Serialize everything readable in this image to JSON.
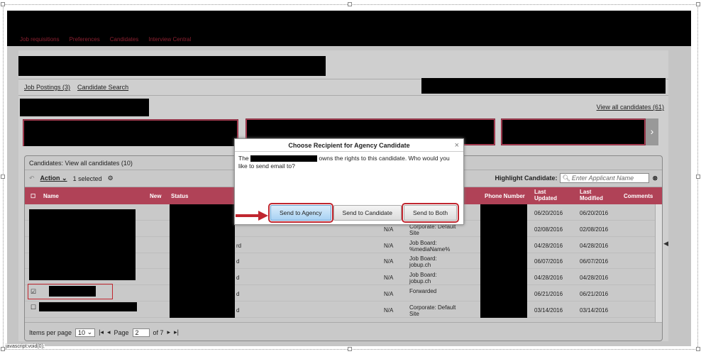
{
  "nav": [
    "Job requisitions",
    "Preferences",
    "Candidates",
    "Interview Central"
  ],
  "links": {
    "postings": "Job Postings (3)",
    "search": "Candidate Search"
  },
  "view_all": "View all candidates (61)",
  "grid": {
    "title": "Candidates: View all candidates (10)",
    "action": "Action",
    "selected": "1 selected",
    "highlight_label": "Highlight Candidate:",
    "highlight_placeholder": "Enter Applicant Name",
    "headers": {
      "name": "Name",
      "new": "New",
      "status": "Status",
      "phone": "Phone Number",
      "last_updated": "Last Updated",
      "last_modified": "Last Modified",
      "comments": "Comments"
    },
    "rows": [
      {
        "na": "",
        "source": "",
        "updated": "06/20/2016",
        "modified": "06/20/2016",
        "status_suffix": ""
      },
      {
        "na": "N/A",
        "source": "Corporate: Default Site",
        "updated": "02/08/2016",
        "modified": "02/08/2016",
        "status_suffix": ""
      },
      {
        "na": "N/A",
        "source": "Job Board: %mediaName%",
        "updated": "04/28/2016",
        "modified": "04/28/2016",
        "status_suffix": "rd"
      },
      {
        "na": "N/A",
        "source": "Job Board: jobup.ch",
        "updated": "06/07/2016",
        "modified": "06/07/2016",
        "status_suffix": "d"
      },
      {
        "na": "N/A",
        "source": "Job Board: jobup.ch",
        "updated": "04/28/2016",
        "modified": "04/28/2016",
        "status_suffix": "d"
      },
      {
        "na": "N/A",
        "source": "Forwarded",
        "updated": "06/21/2016",
        "modified": "06/21/2016",
        "status_suffix": "d"
      },
      {
        "na": "N/A",
        "source": "Corporate: Default Site",
        "updated": "03/14/2016",
        "modified": "03/14/2016",
        "status_suffix": "d"
      }
    ],
    "footer": {
      "items_label": "Items per page",
      "items_value": "10",
      "page_label": "Page",
      "page_value": "2",
      "of_label": "of 7"
    }
  },
  "dialog": {
    "title": "Choose Recipient for Agency Candidate",
    "body_prefix": "The",
    "body_suffix": "owns the rights to this candidate. Who would you like to send email to?",
    "btn_agency": "Send to Agency",
    "btn_candidate": "Send to Candidate",
    "btn_both": "Send to Both"
  },
  "statusbar": "javascript:void(0);"
}
